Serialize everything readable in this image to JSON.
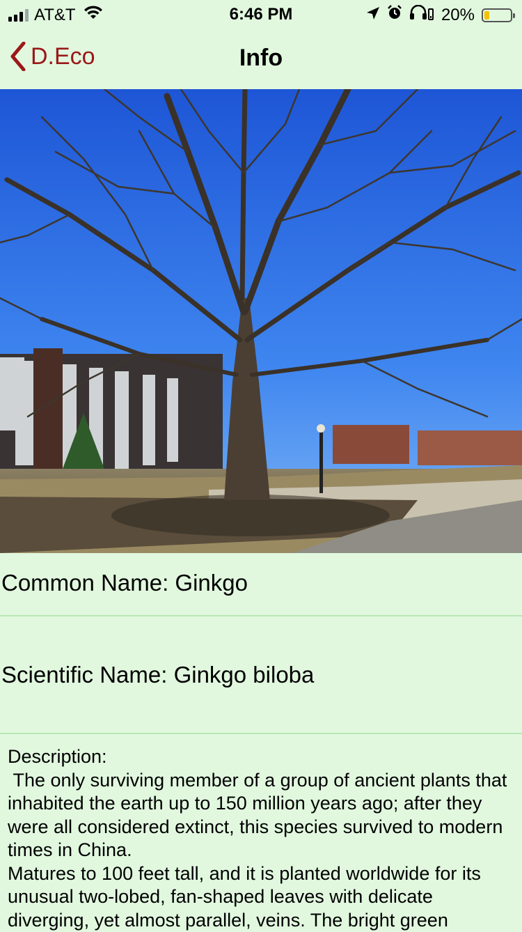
{
  "status_bar": {
    "carrier": "AT&T",
    "time": "6:46 PM",
    "battery_percent": "20%",
    "battery_level": 0.2,
    "icons": [
      "signal-icon",
      "wifi-icon",
      "location-icon",
      "alarm-icon",
      "headphones-icon",
      "battery-icon"
    ]
  },
  "nav": {
    "back_label": "D.Eco",
    "title": "Info",
    "accent_color": "#9b1818"
  },
  "photo": {
    "subject": "tree-photo"
  },
  "plant": {
    "common_name": "Common Name: Ginkgo",
    "scientific_name": "Scientific Name: Ginkgo biloba",
    "description": "Description:\n The only surviving member of a group of ancient plants that inhabited the earth up to 150 million years ago; after they were all considered extinct, this species survived to modern times in China.\nMatures to 100 feet tall, and it is planted worldwide for its unusual two-lobed, fan-shaped leaves with delicate diverging, yet almost parallel, veins. The bright green"
  },
  "colors": {
    "background": "#e1f8df",
    "divider": "#b9e6b5"
  }
}
